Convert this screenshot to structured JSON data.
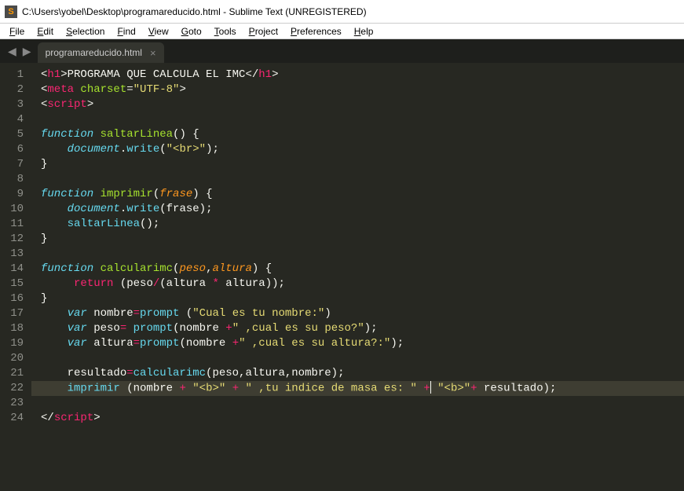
{
  "window": {
    "title": "C:\\Users\\yobel\\Desktop\\programareducido.html - Sublime Text (UNREGISTERED)"
  },
  "menu": {
    "items": [
      "File",
      "Edit",
      "Selection",
      "Find",
      "View",
      "Goto",
      "Tools",
      "Project",
      "Preferences",
      "Help"
    ]
  },
  "tab": {
    "name": "programareducido.html"
  },
  "gutter": {
    "count": 24
  },
  "code": {
    "lines": [
      {
        "n": 1,
        "hl": false,
        "seg": [
          {
            "t": "<",
            "c": "c-punc"
          },
          {
            "t": "h1",
            "c": "c-tag"
          },
          {
            "t": ">",
            "c": "c-punc"
          },
          {
            "t": "PROGRAMA QUE CALCULA EL IMC",
            "c": "c-text"
          },
          {
            "t": "</",
            "c": "c-punc"
          },
          {
            "t": "h1",
            "c": "c-tag"
          },
          {
            "t": ">",
            "c": "c-punc"
          }
        ]
      },
      {
        "n": 2,
        "hl": false,
        "seg": [
          {
            "t": "<",
            "c": "c-punc"
          },
          {
            "t": "meta",
            "c": "c-tag"
          },
          {
            "t": " ",
            "c": "c-punc"
          },
          {
            "t": "charset",
            "c": "c-attr"
          },
          {
            "t": "=",
            "c": "c-punc"
          },
          {
            "t": "\"UTF-8\"",
            "c": "c-str"
          },
          {
            "t": ">",
            "c": "c-punc"
          }
        ]
      },
      {
        "n": 3,
        "hl": false,
        "seg": [
          {
            "t": "<",
            "c": "c-punc"
          },
          {
            "t": "script",
            "c": "c-tag"
          },
          {
            "t": ">",
            "c": "c-punc"
          }
        ]
      },
      {
        "n": 4,
        "hl": false,
        "seg": [
          {
            "t": "",
            "c": "c-text"
          }
        ]
      },
      {
        "n": 5,
        "hl": false,
        "seg": [
          {
            "t": "function",
            "c": "c-kw"
          },
          {
            "t": " ",
            "c": "c-text"
          },
          {
            "t": "saltarLinea",
            "c": "c-fn"
          },
          {
            "t": "() {",
            "c": "c-punc"
          }
        ]
      },
      {
        "n": 6,
        "hl": false,
        "seg": [
          {
            "t": "    ",
            "c": "c-text"
          },
          {
            "t": "document",
            "c": "c-obj"
          },
          {
            "t": ".",
            "c": "c-punc"
          },
          {
            "t": "write",
            "c": "c-call"
          },
          {
            "t": "(",
            "c": "c-punc"
          },
          {
            "t": "\"<br>\"",
            "c": "c-str"
          },
          {
            "t": ");",
            "c": "c-punc"
          }
        ]
      },
      {
        "n": 7,
        "hl": false,
        "seg": [
          {
            "t": "}",
            "c": "c-punc"
          }
        ]
      },
      {
        "n": 8,
        "hl": false,
        "seg": [
          {
            "t": "",
            "c": "c-text"
          }
        ]
      },
      {
        "n": 9,
        "hl": false,
        "seg": [
          {
            "t": "function",
            "c": "c-kw"
          },
          {
            "t": " ",
            "c": "c-text"
          },
          {
            "t": "imprimir",
            "c": "c-fn"
          },
          {
            "t": "(",
            "c": "c-punc"
          },
          {
            "t": "frase",
            "c": "c-param"
          },
          {
            "t": ") {",
            "c": "c-punc"
          }
        ]
      },
      {
        "n": 10,
        "hl": false,
        "seg": [
          {
            "t": "    ",
            "c": "c-text"
          },
          {
            "t": "document",
            "c": "c-obj"
          },
          {
            "t": ".",
            "c": "c-punc"
          },
          {
            "t": "write",
            "c": "c-call"
          },
          {
            "t": "(",
            "c": "c-punc"
          },
          {
            "t": "frase",
            "c": "c-text"
          },
          {
            "t": ");",
            "c": "c-punc"
          }
        ]
      },
      {
        "n": 11,
        "hl": false,
        "seg": [
          {
            "t": "    ",
            "c": "c-text"
          },
          {
            "t": "saltarLinea",
            "c": "c-call"
          },
          {
            "t": "();",
            "c": "c-punc"
          }
        ]
      },
      {
        "n": 12,
        "hl": false,
        "seg": [
          {
            "t": "}",
            "c": "c-punc"
          }
        ]
      },
      {
        "n": 13,
        "hl": false,
        "seg": [
          {
            "t": "",
            "c": "c-text"
          }
        ]
      },
      {
        "n": 14,
        "hl": false,
        "seg": [
          {
            "t": "function",
            "c": "c-kw"
          },
          {
            "t": " ",
            "c": "c-text"
          },
          {
            "t": "calcularimc",
            "c": "c-fn"
          },
          {
            "t": "(",
            "c": "c-punc"
          },
          {
            "t": "peso",
            "c": "c-param"
          },
          {
            "t": ",",
            "c": "c-punc"
          },
          {
            "t": "altura",
            "c": "c-param"
          },
          {
            "t": ") {",
            "c": "c-punc"
          }
        ]
      },
      {
        "n": 15,
        "hl": false,
        "seg": [
          {
            "t": "     ",
            "c": "c-text"
          },
          {
            "t": "return",
            "c": "c-kw2"
          },
          {
            "t": " (peso",
            "c": "c-text"
          },
          {
            "t": "/",
            "c": "c-op"
          },
          {
            "t": "(altura ",
            "c": "c-text"
          },
          {
            "t": "*",
            "c": "c-op"
          },
          {
            "t": " altura));",
            "c": "c-punc"
          }
        ]
      },
      {
        "n": 16,
        "hl": false,
        "seg": [
          {
            "t": "}",
            "c": "c-punc"
          }
        ]
      },
      {
        "n": 17,
        "hl": false,
        "seg": [
          {
            "t": "    ",
            "c": "c-text"
          },
          {
            "t": "var",
            "c": "c-kw"
          },
          {
            "t": " nombre",
            "c": "c-text"
          },
          {
            "t": "=",
            "c": "c-op"
          },
          {
            "t": "prompt",
            "c": "c-call"
          },
          {
            "t": " (",
            "c": "c-punc"
          },
          {
            "t": "\"Cual es tu nombre:\"",
            "c": "c-str"
          },
          {
            "t": ")",
            "c": "c-punc"
          }
        ]
      },
      {
        "n": 18,
        "hl": false,
        "seg": [
          {
            "t": "    ",
            "c": "c-text"
          },
          {
            "t": "var",
            "c": "c-kw"
          },
          {
            "t": " peso",
            "c": "c-text"
          },
          {
            "t": "=",
            "c": "c-op"
          },
          {
            "t": " ",
            "c": "c-text"
          },
          {
            "t": "prompt",
            "c": "c-call"
          },
          {
            "t": "(nombre ",
            "c": "c-punc"
          },
          {
            "t": "+",
            "c": "c-op"
          },
          {
            "t": "\" ,cual es su peso?\"",
            "c": "c-str"
          },
          {
            "t": ");",
            "c": "c-punc"
          }
        ]
      },
      {
        "n": 19,
        "hl": false,
        "seg": [
          {
            "t": "    ",
            "c": "c-text"
          },
          {
            "t": "var",
            "c": "c-kw"
          },
          {
            "t": " altura",
            "c": "c-text"
          },
          {
            "t": "=",
            "c": "c-op"
          },
          {
            "t": "prompt",
            "c": "c-call"
          },
          {
            "t": "(nombre ",
            "c": "c-punc"
          },
          {
            "t": "+",
            "c": "c-op"
          },
          {
            "t": "\" ,cual es su altura?:\"",
            "c": "c-str"
          },
          {
            "t": ");",
            "c": "c-punc"
          }
        ]
      },
      {
        "n": 20,
        "hl": false,
        "seg": [
          {
            "t": "",
            "c": "c-text"
          }
        ]
      },
      {
        "n": 21,
        "hl": false,
        "seg": [
          {
            "t": "    resultado",
            "c": "c-text"
          },
          {
            "t": "=",
            "c": "c-op"
          },
          {
            "t": "calcularimc",
            "c": "c-call"
          },
          {
            "t": "(peso,altura,nombre);",
            "c": "c-punc"
          }
        ]
      },
      {
        "n": 22,
        "hl": true,
        "seg": [
          {
            "t": "    ",
            "c": "c-text"
          },
          {
            "t": "imprimir",
            "c": "c-call"
          },
          {
            "t": " (nombre ",
            "c": "c-punc"
          },
          {
            "t": "+",
            "c": "c-op"
          },
          {
            "t": " ",
            "c": "c-text"
          },
          {
            "t": "\"<b>\"",
            "c": "c-str"
          },
          {
            "t": " ",
            "c": "c-text"
          },
          {
            "t": "+",
            "c": "c-op"
          },
          {
            "t": " ",
            "c": "c-text"
          },
          {
            "t": "\" ,tu indice de masa es: \"",
            "c": "c-str"
          },
          {
            "t": " ",
            "c": "c-text"
          },
          {
            "t": "+",
            "c": "c-op"
          },
          {
            "cursor": true
          },
          {
            "t": " ",
            "c": "c-text"
          },
          {
            "t": "\"<b>\"",
            "c": "c-str"
          },
          {
            "t": "+",
            "c": "c-op"
          },
          {
            "t": " resultado);",
            "c": "c-punc"
          }
        ]
      },
      {
        "n": 23,
        "hl": false,
        "seg": [
          {
            "t": "",
            "c": "c-text"
          }
        ]
      },
      {
        "n": 24,
        "hl": false,
        "seg": [
          {
            "t": "</",
            "c": "c-punc"
          },
          {
            "t": "script",
            "c": "c-tag"
          },
          {
            "t": ">",
            "c": "c-punc"
          }
        ]
      }
    ]
  }
}
